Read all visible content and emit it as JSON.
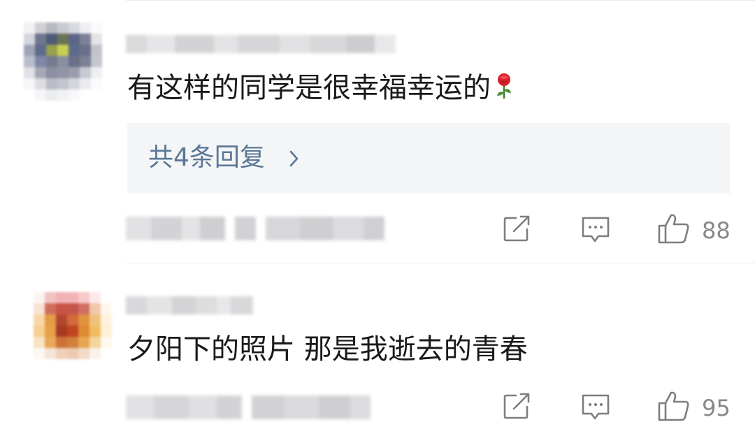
{
  "comments": [
    {
      "text": "有这样的同学是很幸福幸运的",
      "emoji": "rose-emoji",
      "reply_summary": "共4条回复",
      "like_count": "88",
      "avatar_colors": [
        "#f2f2f4",
        "#cfd0d6",
        "#b7b8c2",
        "#c9cad2",
        "#d9dae0",
        "#eeeff2",
        "#fafafa",
        "#d4d5dc",
        "#6f7790",
        "#4e5a79",
        "#6a7356",
        "#5d6684",
        "#7d8298",
        "#e3e4e8",
        "#9ea3b6",
        "#5e6a8c",
        "#97a04f",
        "#c8d052",
        "#5f6a8b",
        "#6a7088",
        "#c2c4cc",
        "#b8bccb",
        "#7e88a5",
        "#767b91",
        "#8a8fa0",
        "#6b7189",
        "#7c8197",
        "#c4c6cf",
        "#e0e1e6",
        "#a6a8b6",
        "#8c8fa1",
        "#9194a6",
        "#9a9cac",
        "#c8cad2",
        "#eeeff2",
        "#f6f6f8",
        "#dcdde2",
        "#b9bbc6",
        "#c3c5ce",
        "#d5d6dc",
        "#ebecef",
        "#fbfbfb",
        "#ffffff",
        "#f6f6f8",
        "#ebecef",
        "#f2f2f4",
        "#f8f8f9",
        "#ffffff",
        "#ffffff"
      ]
    },
    {
      "text": "夕阳下的照片 那是我逝去的青春",
      "reply_summary": "",
      "like_count": "95",
      "avatar_colors": [
        "#fbf4f2",
        "#f1c4c3",
        "#f0b2b4",
        "#f3b3b6",
        "#f6c9c9",
        "#fde9ea",
        "#ffffff",
        "#f6e3d6",
        "#d26d5c",
        "#c95446",
        "#c6544b",
        "#d07062",
        "#f1c9a8",
        "#fff7ee",
        "#f7d7a6",
        "#e39c46",
        "#b3482f",
        "#d26a3a",
        "#e0923f",
        "#f0c17d",
        "#fff3df",
        "#f7cf8e",
        "#e8a04b",
        "#a53a22",
        "#c1451f",
        "#dd8b34",
        "#f0bd62",
        "#fff1d6",
        "#f8e3c4",
        "#e7a859",
        "#cf7236",
        "#d27f3c",
        "#e6a650",
        "#f4d59b",
        "#fff9ee",
        "#fdf8f3",
        "#f5e5d8",
        "#eed0b8",
        "#eccab0",
        "#f1dac6",
        "#faf1e9",
        "#ffffff",
        "#ffffff",
        "#ffffff",
        "#ffffff",
        "#ffffff",
        "#ffffff",
        "#ffffff",
        "#ffffff"
      ]
    }
  ]
}
